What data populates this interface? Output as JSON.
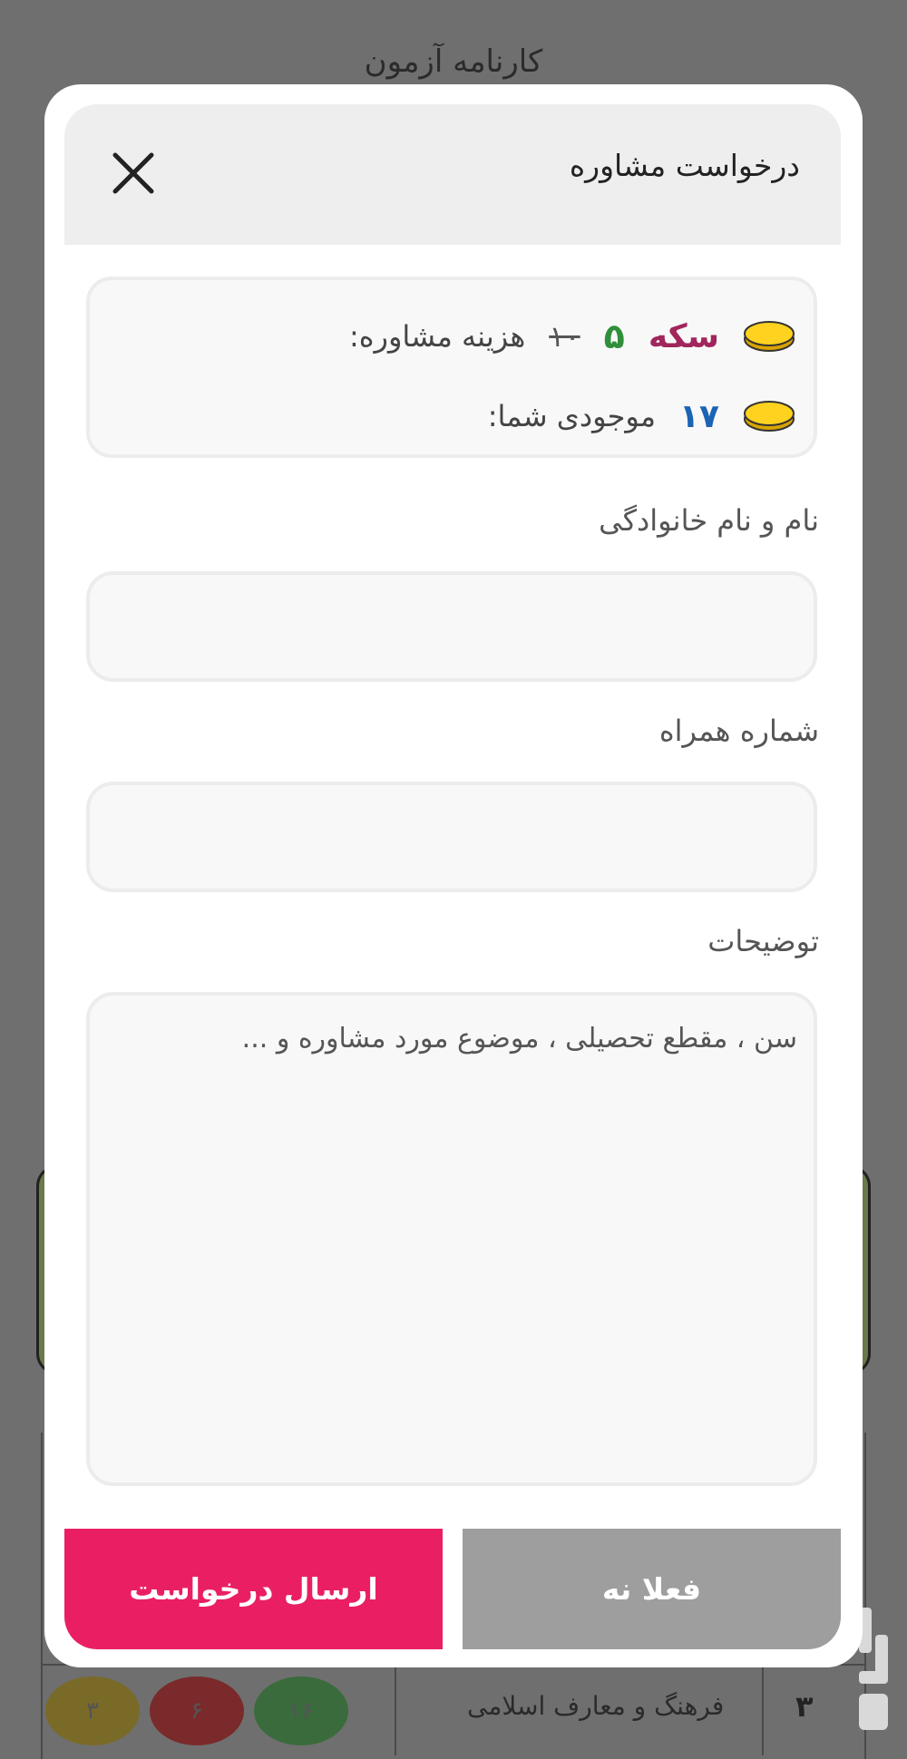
{
  "background": {
    "page_title": "کارنامه آزمون",
    "row": {
      "number": "۳",
      "lesson": "فرهنگ و معارف اسلامی",
      "scores": [
        "۱۶",
        "۶",
        "۳"
      ],
      "score_colors": [
        "#2e7d32",
        "#a32424",
        "#b89a1e"
      ]
    }
  },
  "modal": {
    "title": "درخواست مشاوره",
    "cost_label": "هزینه مشاوره:",
    "old_price": "۱۰",
    "new_price": "۵",
    "coin_word": "سکه",
    "balance_label": "موجودی شما:",
    "balance_value": "۱۷",
    "fields": {
      "name_label": "نام و نام خانوادگی",
      "phone_label": "شماره همراه",
      "notes_label": "توضیحات",
      "notes_placeholder": "سن ، مقطع تحصیلی ، موضوع مورد مشاوره و ..."
    },
    "buttons": {
      "submit": "ارسال درخواست",
      "later": "فعلا نه"
    }
  },
  "colors": {
    "submit_button": "#ea1f63",
    "later_button": "#9e9e9e",
    "new_price": "#2f8f3b",
    "coin_word": "#a0265c",
    "balance": "#1a63b5"
  }
}
